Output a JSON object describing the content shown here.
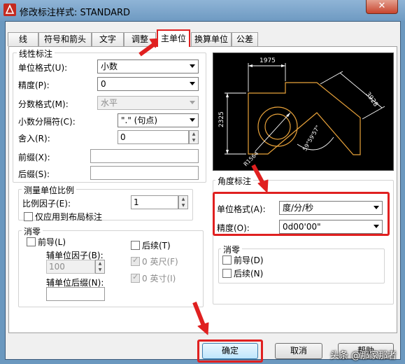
{
  "window": {
    "title": "修改标注样式: STANDARD",
    "close_label": "✕"
  },
  "tabs": [
    {
      "label": "线"
    },
    {
      "label": "符号和箭头"
    },
    {
      "label": "文字"
    },
    {
      "label": "调整"
    },
    {
      "label": "主单位",
      "active": true
    },
    {
      "label": "换算单位"
    },
    {
      "label": "公差"
    }
  ],
  "linear": {
    "title": "线性标注",
    "unit_format_label": "单位格式(U):",
    "unit_format_value": "小数",
    "precision_label": "精度(P):",
    "precision_value": "0",
    "fraction_label": "分数格式(M):",
    "fraction_value": "水平",
    "decimal_sep_label": "小数分隔符(C):",
    "decimal_sep_value": "\".\" (句点)",
    "round_label": "舍入(R):",
    "round_value": "0",
    "prefix_label": "前缀(X):",
    "prefix_value": "",
    "suffix_label": "后缀(S):",
    "suffix_value": ""
  },
  "scale": {
    "title": "测量单位比例",
    "factor_label": "比例因子(E):",
    "factor_value": "1",
    "layout_only_label": "仅应用到布局标注"
  },
  "zero_suppress": {
    "title": "消零",
    "leading_label": "前导(L)",
    "sub_factor_label": "辅单位因子(B):",
    "sub_factor_value": "100",
    "sub_suffix_label": "辅单位后缀(N):",
    "sub_suffix_value": "",
    "trailing_label": "后续(T)",
    "feet_label": "0 英尺(F)",
    "inches_label": "0 英寸(I)"
  },
  "preview": {
    "dim_top": "1975",
    "dim_left": "2325",
    "dim_right": "3928",
    "dim_radius": "R1564",
    "dim_angle": "59°59'57\""
  },
  "angular": {
    "title": "角度标注",
    "unit_format_label": "单位格式(A):",
    "unit_format_value": "度/分/秒",
    "precision_label": "精度(O):",
    "precision_value": "0d00'00\""
  },
  "angular_zero": {
    "title": "消零",
    "leading_label": "前导(D)",
    "trailing_label": "后续(N)"
  },
  "buttons": {
    "ok": "确定",
    "cancel": "取消",
    "help": "帮助"
  },
  "watermark": "头条 @那家那者"
}
